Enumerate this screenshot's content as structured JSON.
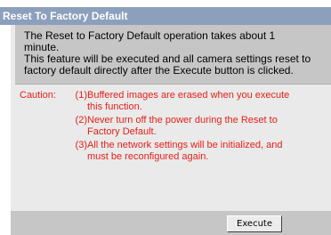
{
  "header": {
    "title": "Reset To Factory Default"
  },
  "info": {
    "lines": [
      "The Reset to Factory Default operation takes about 1",
      "minute.",
      "This feature will be executed and all camera settings reset to",
      "factory default directly after the Execute button is clicked."
    ]
  },
  "caution": {
    "label": "Caution:",
    "items": [
      {
        "num": "(1)",
        "lines": [
          "Buffered images are erased when you execute",
          "this function."
        ]
      },
      {
        "num": "(2)",
        "lines": [
          "Never turn off the power during the Reset to",
          "Factory Default."
        ]
      },
      {
        "num": "(3)",
        "lines": [
          "All the network settings will be initialized, and",
          "must be reconfigured again."
        ]
      }
    ]
  },
  "footer": {
    "execute_label": "Execute"
  },
  "colors": {
    "title_bar": "#8c9fbd",
    "info_box": "#c6c6c6",
    "body_area": "#eaeaea",
    "caution_text": "#e4201a"
  }
}
